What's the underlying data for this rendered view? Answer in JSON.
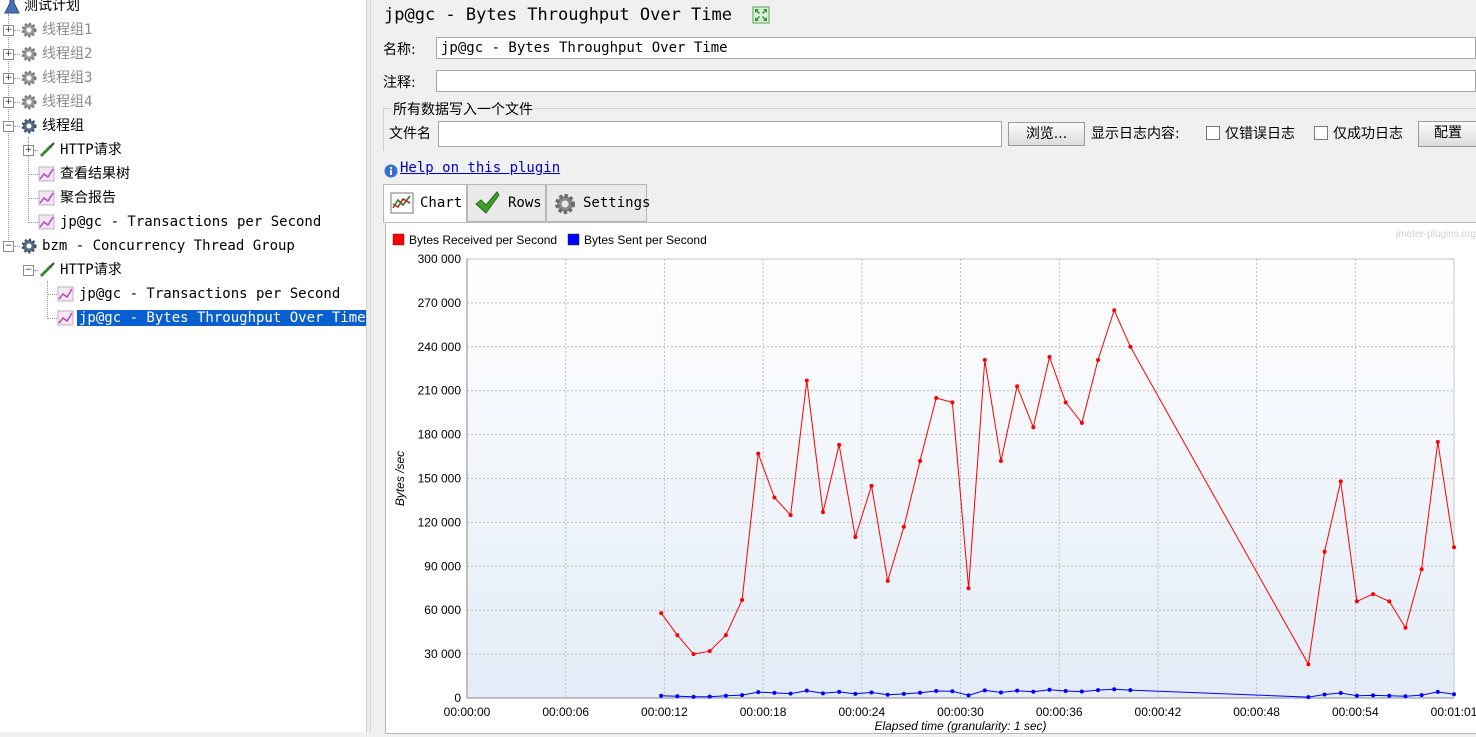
{
  "tree": {
    "root": "测试计划",
    "items": [
      {
        "label": "线程组1"
      },
      {
        "label": "线程组2"
      },
      {
        "label": "线程组3"
      },
      {
        "label": "线程组4"
      },
      {
        "label": "线程组"
      },
      {
        "label": "HTTP请求"
      },
      {
        "label": "查看结果树"
      },
      {
        "label": "聚合报告"
      },
      {
        "label": "jp@gc - Transactions per Second"
      },
      {
        "label": "bzm - Concurrency Thread Group"
      },
      {
        "label": "HTTP请求"
      },
      {
        "label": "jp@gc - Transactions per Second"
      },
      {
        "label": "jp@gc - Bytes Throughput Over Time"
      }
    ]
  },
  "panel": {
    "title": "jp@gc - Bytes Throughput Over Time",
    "name_label": "名称:",
    "name_value": "jp@gc - Bytes Throughput Over Time",
    "comment_label": "注释:",
    "comment_value": "",
    "file_group_title": "所有数据写入一个文件",
    "filename_label": "文件名",
    "filename_value": "",
    "browse_button": "浏览...",
    "log_display_label": "显示日志内容:",
    "errors_only_label": "仅错误日志",
    "success_only_label": "仅成功日志",
    "config_button": "配置",
    "help_link": "Help on this plugin",
    "tabs": [
      {
        "label": "Chart"
      },
      {
        "label": "Rows"
      },
      {
        "label": "Settings"
      }
    ]
  },
  "colors": {
    "received": "#ff0000",
    "sent": "#0000ff",
    "selection": "#0a5fd0"
  },
  "chart_data": {
    "type": "line",
    "watermark": "jmeter-plugins.org",
    "xlabel": "Elapsed time (granularity: 1 sec)",
    "ylabel": "Bytes /sec",
    "xlim": [
      0,
      61
    ],
    "ylim": [
      0,
      300000
    ],
    "x_ticks": [
      "00:00:00",
      "00:00:06",
      "00:00:12",
      "00:00:18",
      "00:00:24",
      "00:00:30",
      "00:00:36",
      "00:00:42",
      "00:00:48",
      "00:00:54",
      "00:01:01"
    ],
    "y_ticks": [
      "0",
      "30 000",
      "60 000",
      "90 000",
      "120 000",
      "150 000",
      "180 000",
      "210 000",
      "240 000",
      "270 000",
      "300 000"
    ],
    "series": [
      {
        "name": "Bytes Received per Second",
        "x": [
          12,
          13,
          14,
          15,
          16,
          17,
          18,
          19,
          20,
          21,
          22,
          23,
          24,
          25,
          26,
          27,
          28,
          29,
          30,
          31,
          32,
          33,
          34,
          35,
          36,
          37,
          38,
          39,
          40,
          41,
          52,
          53,
          54,
          55,
          56,
          57,
          58,
          59,
          60,
          61
        ],
        "values": [
          58000,
          43000,
          30000,
          32000,
          43000,
          67000,
          167000,
          137000,
          125000,
          217000,
          127000,
          173000,
          110000,
          145000,
          80000,
          117000,
          162000,
          205000,
          202000,
          75000,
          231000,
          162000,
          213000,
          185000,
          233000,
          202000,
          188000,
          231000,
          265000,
          240000,
          23000,
          100000,
          148000,
          66000,
          71000,
          66000,
          48000,
          88000,
          175000,
          103000
        ]
      },
      {
        "name": "Bytes Sent per Second",
        "x": [
          12,
          13,
          14,
          15,
          16,
          17,
          18,
          19,
          20,
          21,
          22,
          23,
          24,
          25,
          26,
          27,
          28,
          29,
          30,
          31,
          32,
          33,
          34,
          35,
          36,
          37,
          38,
          39,
          40,
          41,
          52,
          53,
          54,
          55,
          56,
          57,
          58,
          59,
          60,
          61
        ],
        "values": [
          1500,
          1200,
          800,
          900,
          1500,
          2000,
          4000,
          3500,
          3000,
          5000,
          3200,
          4200,
          2800,
          3800,
          2200,
          2800,
          3600,
          4800,
          4600,
          1800,
          5200,
          3800,
          5000,
          4300,
          5600,
          4800,
          4400,
          5400,
          6000,
          5400,
          600,
          2400,
          3400,
          1500,
          1800,
          1500,
          1200,
          2000,
          4200,
          2600
        ]
      }
    ]
  }
}
